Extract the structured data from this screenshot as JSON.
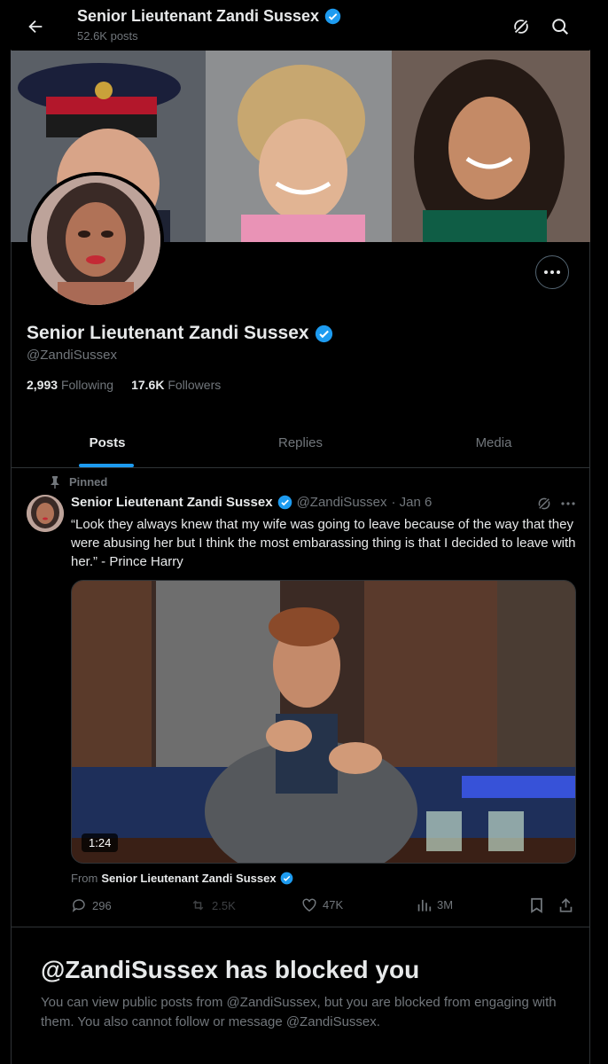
{
  "header": {
    "title": "Senior Lieutenant Zandi Sussex",
    "posts_count": "52.6K posts"
  },
  "profile": {
    "display_name": "Senior Lieutenant Zandi Sussex",
    "handle": "@ZandiSussex",
    "following_count": "2,993",
    "following_label": "Following",
    "followers_count": "17.6K",
    "followers_label": "Followers"
  },
  "tabs": [
    {
      "label": "Posts",
      "active": true
    },
    {
      "label": "Replies",
      "active": false
    },
    {
      "label": "Media",
      "active": false
    }
  ],
  "post": {
    "pinned_label": "Pinned",
    "author": "Senior Lieutenant Zandi Sussex",
    "handle": "@ZandiSussex",
    "date": "· Jan 6",
    "text": "“Look they always knew that my wife was going to leave because of the way that they were abusing her but I think the most embarassing thing is that I decided to leave with her.” - Prince Harry",
    "video_duration": "1:24",
    "from_label": "From",
    "from_author": "Senior Lieutenant Zandi Sussex",
    "stats": {
      "replies": "296",
      "reposts": "2.5K",
      "likes": "47K",
      "views": "3M"
    }
  },
  "blocked": {
    "title": "@ZandiSussex has blocked you",
    "message": "You can view public posts from @ZandiSussex, but you are blocked from engaging with them. You also cannot follow or message @ZandiSussex."
  },
  "colors": {
    "accent": "#1d9bf0",
    "background": "#000000",
    "muted_text": "#71767b",
    "primary_text": "#e7e9ea"
  }
}
